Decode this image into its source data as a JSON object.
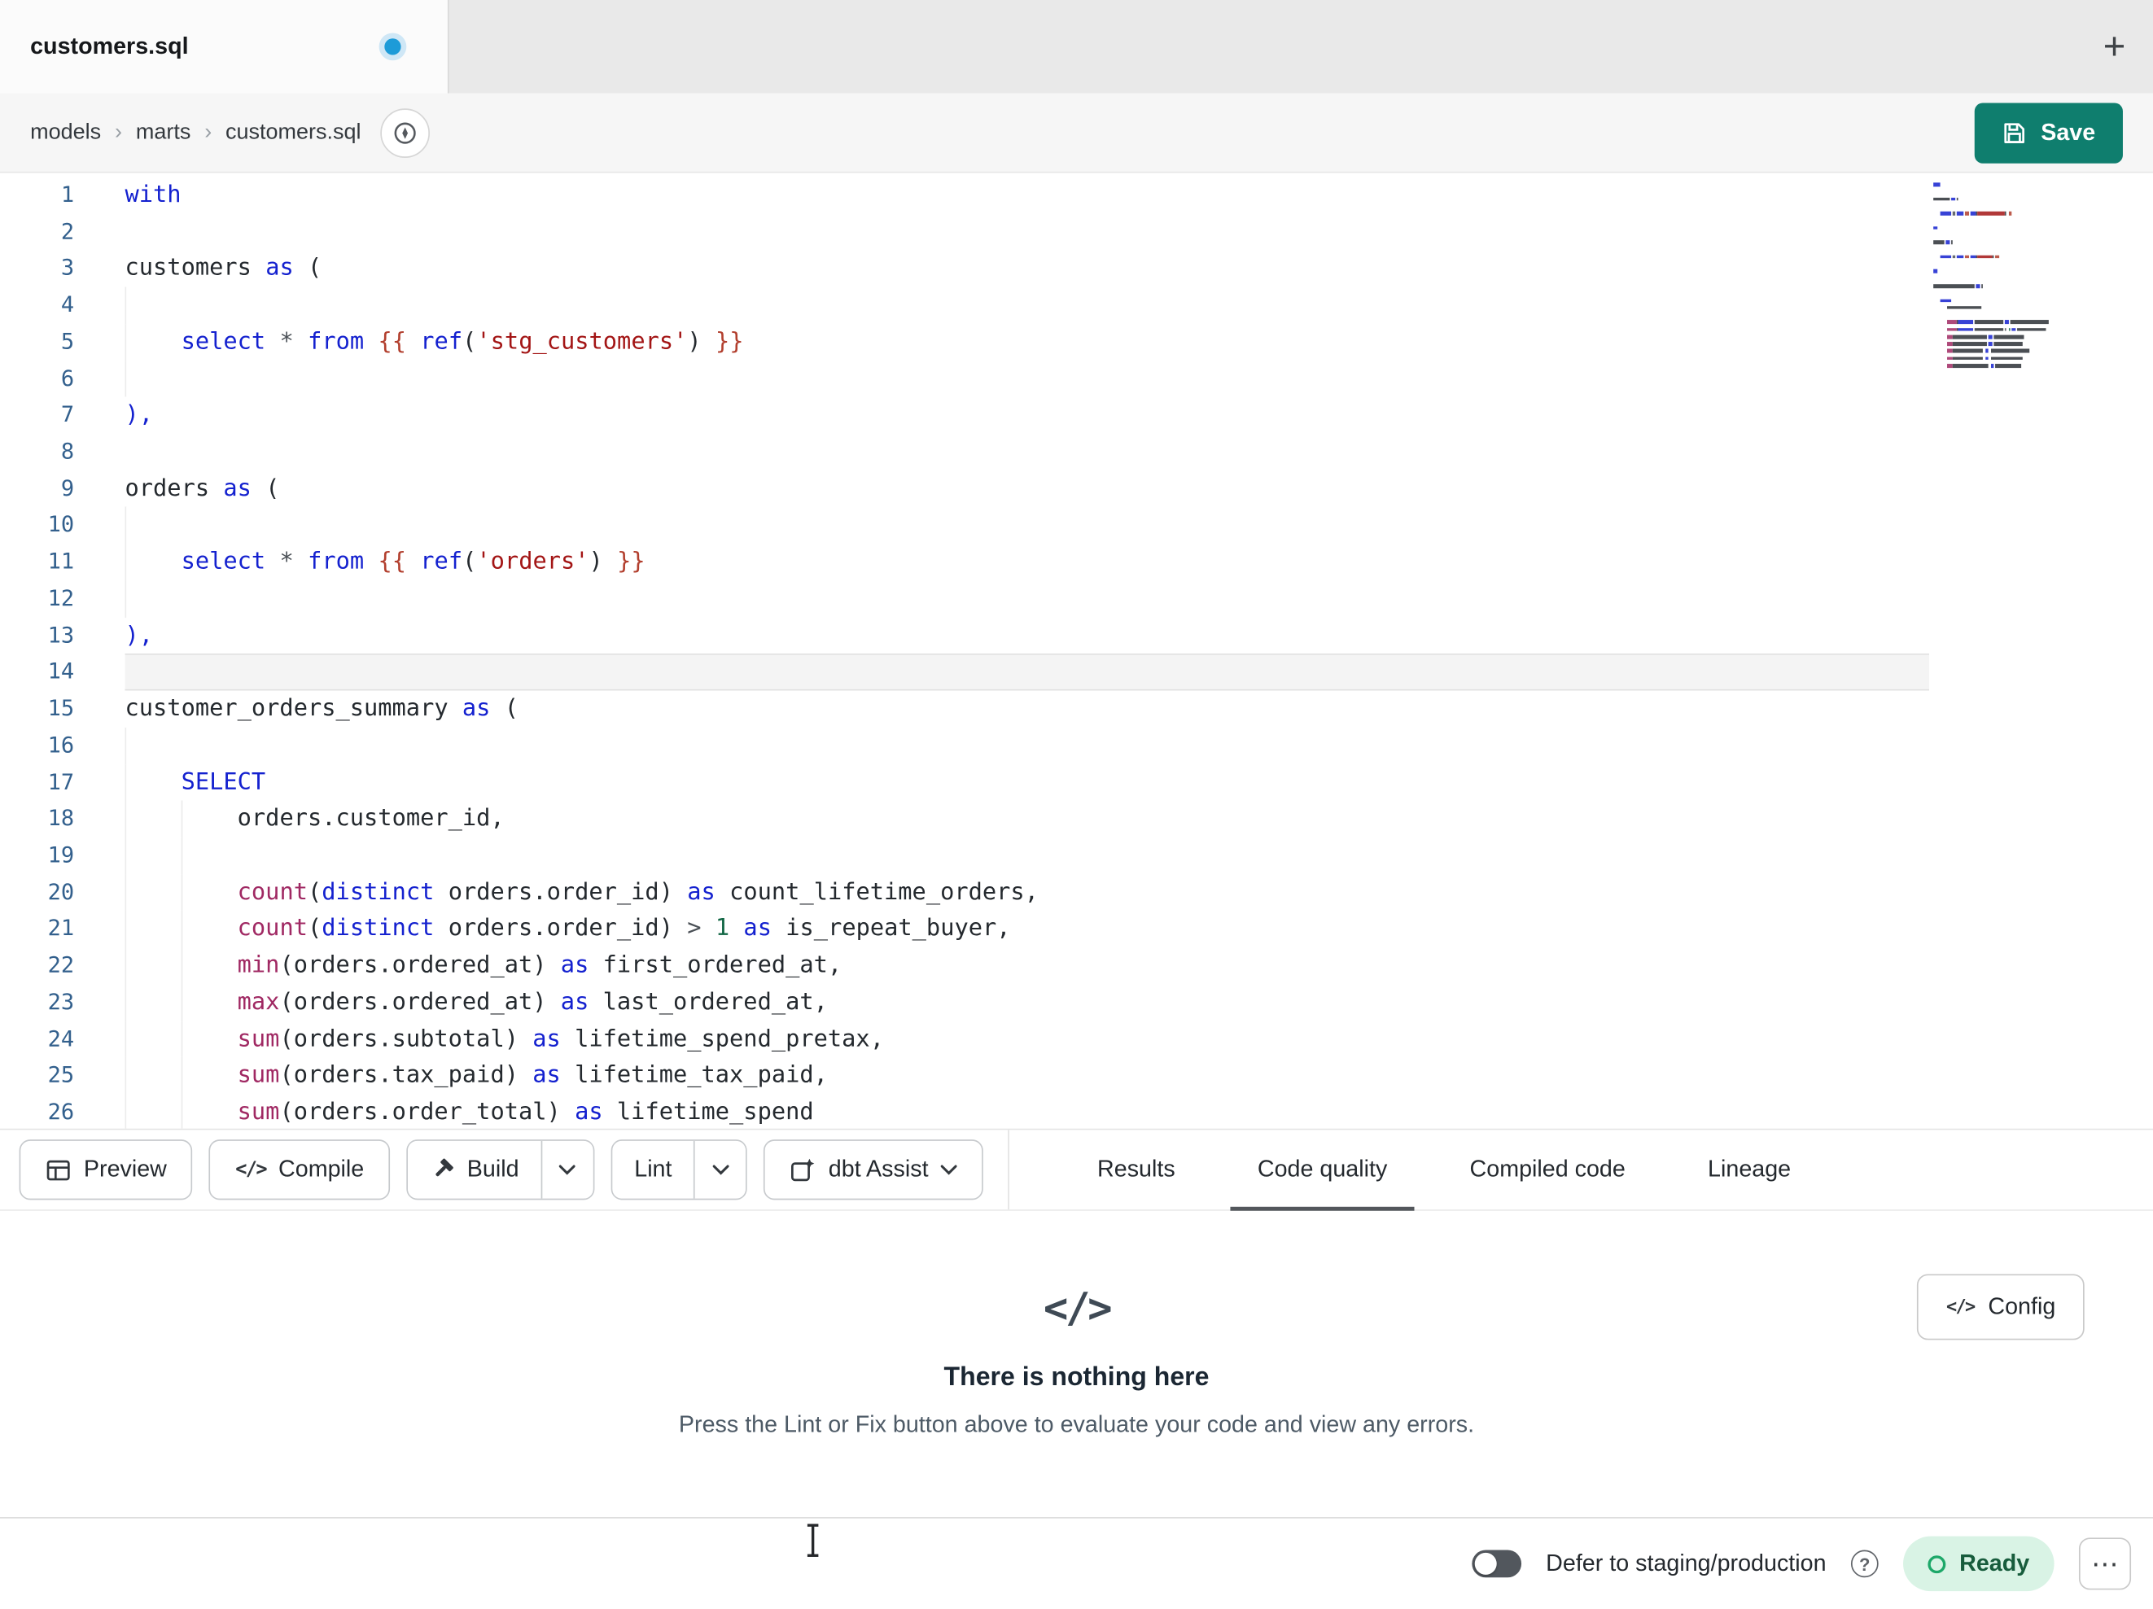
{
  "tab_bar": {
    "tabs": [
      {
        "label": "customers.sql",
        "active": true,
        "modified": true
      }
    ],
    "new_tab": "+"
  },
  "breadcrumb": {
    "items": [
      "models",
      "marts",
      "customers.sql"
    ],
    "separator": "›"
  },
  "actions": {
    "save": "Save"
  },
  "icons": {
    "code_glyph": "</>"
  },
  "editor": {
    "active_line": 14,
    "lines": [
      {
        "segs": [
          [
            "k",
            "with"
          ]
        ]
      },
      {
        "segs": []
      },
      {
        "segs": [
          [
            "p",
            "customers"
          ],
          [
            "w",
            " "
          ],
          [
            "k",
            "as"
          ],
          [
            "w",
            " "
          ],
          [
            "p",
            "("
          ]
        ]
      },
      {
        "segs": [],
        "g": [
          0
        ]
      },
      {
        "segs": [
          [
            "w",
            "    "
          ],
          [
            "k",
            "select"
          ],
          [
            "w",
            " "
          ],
          [
            "o",
            "*"
          ],
          [
            "w",
            " "
          ],
          [
            "k",
            "from"
          ],
          [
            "w",
            " "
          ],
          [
            "j",
            "{{"
          ],
          [
            "w",
            " "
          ],
          [
            "k",
            "ref"
          ],
          [
            "p",
            "("
          ],
          [
            "s",
            "'stg_customers'"
          ],
          [
            "p",
            ")"
          ],
          [
            "w",
            " "
          ],
          [
            "j",
            "}}"
          ]
        ],
        "g": [
          0
        ]
      },
      {
        "segs": [],
        "g": [
          0
        ]
      },
      {
        "segs": [
          [
            "b",
            "),"
          ]
        ]
      },
      {
        "segs": []
      },
      {
        "segs": [
          [
            "p",
            "orders"
          ],
          [
            "w",
            " "
          ],
          [
            "k",
            "as"
          ],
          [
            "w",
            " "
          ],
          [
            "p",
            "("
          ]
        ]
      },
      {
        "segs": [],
        "g": [
          0
        ]
      },
      {
        "segs": [
          [
            "w",
            "    "
          ],
          [
            "k",
            "select"
          ],
          [
            "w",
            " "
          ],
          [
            "o",
            "*"
          ],
          [
            "w",
            " "
          ],
          [
            "k",
            "from"
          ],
          [
            "w",
            " "
          ],
          [
            "j",
            "{{"
          ],
          [
            "w",
            " "
          ],
          [
            "k",
            "ref"
          ],
          [
            "p",
            "("
          ],
          [
            "s",
            "'orders'"
          ],
          [
            "p",
            ")"
          ],
          [
            "w",
            " "
          ],
          [
            "j",
            "}}"
          ]
        ],
        "g": [
          0
        ]
      },
      {
        "segs": [],
        "g": [
          0
        ]
      },
      {
        "segs": [
          [
            "b",
            "),"
          ]
        ]
      },
      {
        "segs": []
      },
      {
        "segs": [
          [
            "p",
            "customer_orders_summary"
          ],
          [
            "w",
            " "
          ],
          [
            "k",
            "as"
          ],
          [
            "w",
            " "
          ],
          [
            "p",
            "("
          ]
        ]
      },
      {
        "segs": [],
        "g": [
          0
        ]
      },
      {
        "segs": [
          [
            "w",
            "    "
          ],
          [
            "k",
            "SELECT"
          ]
        ],
        "g": [
          0
        ]
      },
      {
        "segs": [
          [
            "w",
            "        "
          ],
          [
            "p",
            "orders.customer_id,"
          ]
        ],
        "g": [
          0,
          4
        ]
      },
      {
        "segs": [],
        "g": [
          0,
          4
        ]
      },
      {
        "segs": [
          [
            "w",
            "        "
          ],
          [
            "f",
            "count"
          ],
          [
            "p",
            "("
          ],
          [
            "k",
            "distinct"
          ],
          [
            "w",
            " "
          ],
          [
            "p",
            "orders.order_id)"
          ],
          [
            "w",
            " "
          ],
          [
            "k",
            "as"
          ],
          [
            "w",
            " "
          ],
          [
            "p",
            "count_lifetime_orders,"
          ]
        ],
        "g": [
          0,
          4
        ]
      },
      {
        "segs": [
          [
            "w",
            "        "
          ],
          [
            "f",
            "count"
          ],
          [
            "p",
            "("
          ],
          [
            "k",
            "distinct"
          ],
          [
            "w",
            " "
          ],
          [
            "p",
            "orders.order_id)"
          ],
          [
            "w",
            " "
          ],
          [
            "o",
            ">"
          ],
          [
            "w",
            " "
          ],
          [
            "n",
            "1"
          ],
          [
            "w",
            " "
          ],
          [
            "k",
            "as"
          ],
          [
            "w",
            " "
          ],
          [
            "p",
            "is_repeat_buyer,"
          ]
        ],
        "g": [
          0,
          4
        ]
      },
      {
        "segs": [
          [
            "w",
            "        "
          ],
          [
            "f",
            "min"
          ],
          [
            "p",
            "(orders.ordered_at)"
          ],
          [
            "w",
            " "
          ],
          [
            "k",
            "as"
          ],
          [
            "w",
            " "
          ],
          [
            "p",
            "first_ordered_at,"
          ]
        ],
        "g": [
          0,
          4
        ]
      },
      {
        "segs": [
          [
            "w",
            "        "
          ],
          [
            "f",
            "max"
          ],
          [
            "p",
            "(orders.ordered_at)"
          ],
          [
            "w",
            " "
          ],
          [
            "k",
            "as"
          ],
          [
            "w",
            " "
          ],
          [
            "p",
            "last_ordered_at,"
          ]
        ],
        "g": [
          0,
          4
        ]
      },
      {
        "segs": [
          [
            "w",
            "        "
          ],
          [
            "f",
            "sum"
          ],
          [
            "p",
            "(orders.subtotal)"
          ],
          [
            "w",
            " "
          ],
          [
            "k",
            "as"
          ],
          [
            "w",
            " "
          ],
          [
            "p",
            "lifetime_spend_pretax,"
          ]
        ],
        "g": [
          0,
          4
        ]
      },
      {
        "segs": [
          [
            "w",
            "        "
          ],
          [
            "f",
            "sum"
          ],
          [
            "p",
            "(orders.tax_paid)"
          ],
          [
            "w",
            " "
          ],
          [
            "k",
            "as"
          ],
          [
            "w",
            " "
          ],
          [
            "p",
            "lifetime_tax_paid,"
          ]
        ],
        "g": [
          0,
          4
        ]
      },
      {
        "segs": [
          [
            "w",
            "        "
          ],
          [
            "f",
            "sum"
          ],
          [
            "p",
            "(orders.order_total)"
          ],
          [
            "w",
            " "
          ],
          [
            "k",
            "as"
          ],
          [
            "w",
            " "
          ],
          [
            "p",
            "lifetime_spend"
          ]
        ],
        "g": [
          0,
          4
        ]
      }
    ]
  },
  "toolbar": {
    "preview": "Preview",
    "compile": "Compile",
    "build": "Build",
    "lint": "Lint",
    "dbt_assist": "dbt Assist"
  },
  "panel_tabs": [
    {
      "label": "Results",
      "active": false
    },
    {
      "label": "Code quality",
      "active": true
    },
    {
      "label": "Compiled code",
      "active": false
    },
    {
      "label": "Lineage",
      "active": false
    }
  ],
  "results_panel": {
    "title": "There is nothing here",
    "subtitle": "Press the Lint or Fix button above to evaluate your code and view any errors.",
    "config": "Config"
  },
  "status_bar": {
    "defer_label": "Defer to staging/production",
    "ready": "Ready",
    "menu": "⋯"
  },
  "colors": {
    "accent_teal": "#0f7e6e",
    "tab_dot_blue": "#1d9bd8",
    "keyword": "#1421cf",
    "function": "#a02963",
    "jinja": "#b23f2e",
    "string": "#a31515",
    "number": "#116644",
    "operator": "#4a5056",
    "plain_text": "#24292e",
    "line_number": "#33608d",
    "ready_badge_bg": "#d9f3e5",
    "ready_badge_text": "#175c3c",
    "ready_ring": "#1da869",
    "active_tab_underline": "#53575c"
  }
}
